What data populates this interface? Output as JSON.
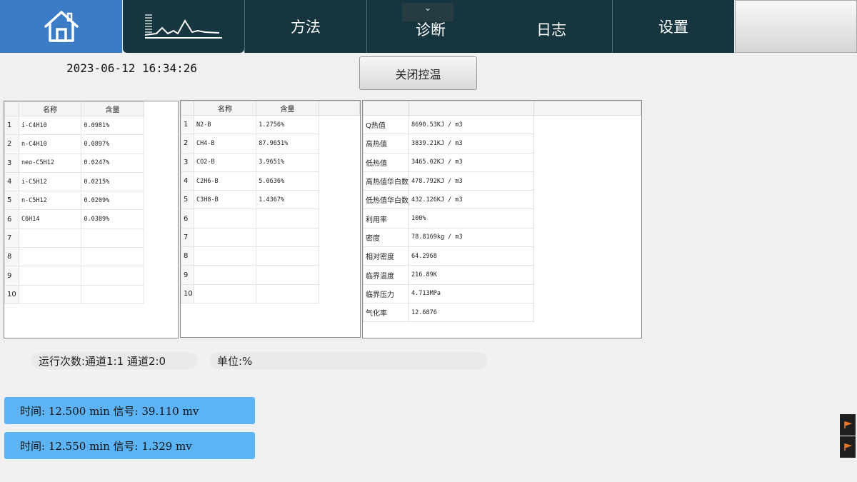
{
  "nav": {
    "home_icon": "home-icon",
    "chart_icon": "chromatogram-icon",
    "tabs": [
      {
        "label": "方法"
      },
      {
        "label": "诊断"
      },
      {
        "label": "日志"
      },
      {
        "label": "设置"
      }
    ],
    "dropdown_icon": "chevron-down-icon"
  },
  "datetime": "2023-06-12 16:34:26",
  "control_button": "关闭控温",
  "table1": {
    "headers": [
      "名称",
      "含量"
    ],
    "rows": [
      {
        "idx": "1",
        "name": "i-C4H10",
        "value": "0.0981%"
      },
      {
        "idx": "2",
        "name": "n-C4H10",
        "value": "0.0897%"
      },
      {
        "idx": "3",
        "name": "neo-C5H12",
        "value": "0.0247%"
      },
      {
        "idx": "4",
        "name": "i-C5H12",
        "value": "0.0215%"
      },
      {
        "idx": "5",
        "name": "n-C5H12",
        "value": "0.0209%"
      },
      {
        "idx": "6",
        "name": "C6H14",
        "value": "0.0389%"
      },
      {
        "idx": "7",
        "name": "",
        "value": ""
      },
      {
        "idx": "8",
        "name": "",
        "value": ""
      },
      {
        "idx": "9",
        "name": "",
        "value": ""
      },
      {
        "idx": "10",
        "name": "",
        "value": ""
      }
    ]
  },
  "table2": {
    "headers": [
      "名称",
      "含量"
    ],
    "rows": [
      {
        "idx": "1",
        "name": "N2-B",
        "value": "1.2756%"
      },
      {
        "idx": "2",
        "name": "CH4-B",
        "value": "87.9651%"
      },
      {
        "idx": "3",
        "name": "CO2-B",
        "value": "3.9651%"
      },
      {
        "idx": "4",
        "name": "C2H6-B",
        "value": "5.0636%"
      },
      {
        "idx": "5",
        "name": "C3H8-B",
        "value": "1.4367%"
      },
      {
        "idx": "6",
        "name": "",
        "value": ""
      },
      {
        "idx": "7",
        "name": "",
        "value": ""
      },
      {
        "idx": "8",
        "name": "",
        "value": ""
      },
      {
        "idx": "9",
        "name": "",
        "value": ""
      },
      {
        "idx": "10",
        "name": "",
        "value": ""
      }
    ]
  },
  "table3": {
    "rows": [
      {
        "name": "Q热值",
        "value": "8690.53KJ / m3"
      },
      {
        "name": "高热值",
        "value": "3839.21KJ / m3"
      },
      {
        "name": "低热值",
        "value": "3465.02KJ / m3"
      },
      {
        "name": "高热值华白数",
        "value": "478.792KJ / m3"
      },
      {
        "name": "低热值华白数",
        "value": "432.126KJ / m3"
      },
      {
        "name": "利用率",
        "value": "100%"
      },
      {
        "name": "密度",
        "value": "78.8169kg / m3"
      },
      {
        "name": "相对密度",
        "value": "64.2968"
      },
      {
        "name": "临界温度",
        "value": "216.89K"
      },
      {
        "name": "临界压力",
        "value": "4.713MPa"
      },
      {
        "name": "气化率",
        "value": "12.6876"
      }
    ]
  },
  "status": {
    "run_count": "运行次数:通道1:1  通道2:0",
    "unit": "单位:%"
  },
  "signals": [
    {
      "text": "时间: 12.500 min  信号: 39.110 mv"
    },
    {
      "text": "时间: 12.550 min  信号: 1.329 mv"
    }
  ],
  "colors": {
    "nav_dark": "#16353e",
    "nav_home": "#3a7cc6",
    "signal_box": "#5db4f5"
  }
}
